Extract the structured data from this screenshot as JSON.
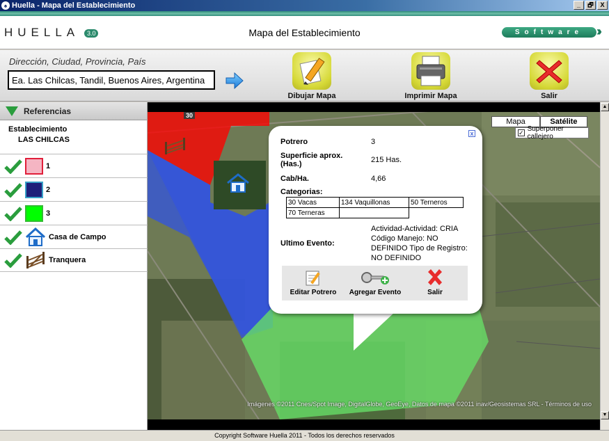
{
  "window": {
    "title": "Huella - Mapa del Establecimiento",
    "buttons": [
      "_",
      "🗗",
      "X"
    ]
  },
  "header": {
    "logo_text": "HUELLA",
    "logo_version": "3.0",
    "title": "Mapa del Establecimiento",
    "badge": "Software"
  },
  "search": {
    "label": "Dirección, Ciudad, Provincia, País",
    "value": "Ea. Las Chilcas, Tandil, Buenos Aires, Argentina"
  },
  "toolbar": {
    "draw_label": "Dibujar Mapa",
    "print_label": "Imprimir Mapa",
    "exit_label": "Salir"
  },
  "sidebar": {
    "title": "Referencias",
    "establishment_label": "Establecimiento",
    "establishment_name": "LAS CHILCAS",
    "items": [
      {
        "label": "1",
        "icon": "pink-swatch",
        "color": "#f5b5c3",
        "border": "#e01f3a"
      },
      {
        "label": "2",
        "icon": "navy-swatch",
        "color": "#1e1f7a",
        "border": "#39a1c8"
      },
      {
        "label": "3",
        "icon": "green-swatch",
        "color": "#00ff00",
        "border": "#33bb33"
      },
      {
        "label": "Casa de Campo",
        "icon": "house-icon"
      },
      {
        "label": "Tranquera",
        "icon": "gate-icon"
      }
    ]
  },
  "map": {
    "type_options": [
      "Mapa",
      "Satélite"
    ],
    "selected_type": "Satélite",
    "overlay_label": "Superponer callejero",
    "overlay_checked": true,
    "road_marker": "30",
    "attribution": "Imágenes ©2011 Cnes/Spot Image, DigitalGlobe, GeoEye, Datos de mapa ©2011 inav/Geosistemas SRL - Términos de uso",
    "colors": {
      "red_paddock": "#ff0000",
      "blue_paddock": "#3355dd",
      "green_paddock": "#66dd66"
    }
  },
  "info": {
    "potrero_label": "Potrero",
    "potrero_value": "3",
    "superficie_label": "Superficie aprox. (Has.)",
    "superficie_value": "215 Has.",
    "cab_label": "Cab/Ha.",
    "cab_value": "4,66",
    "categorias_label": "Categorias:",
    "categorias": [
      "30 Vacas",
      "134 Vaquillonas",
      "50 Terneros",
      "70 Terneras"
    ],
    "evento_label": "Ultimo Evento:",
    "evento_value": "Actividad-Actividad: CRIA Código Manejo: NO DEFINIDO Tipo de Registro: NO DEFINIDO",
    "close_label": "x",
    "edit_label": "Editar Potrero",
    "add_label": "Agregar Evento",
    "exit_label": "Salir"
  },
  "footer": {
    "text": "Copyright Software Huella 2011 - Todos los derechos reservados"
  }
}
